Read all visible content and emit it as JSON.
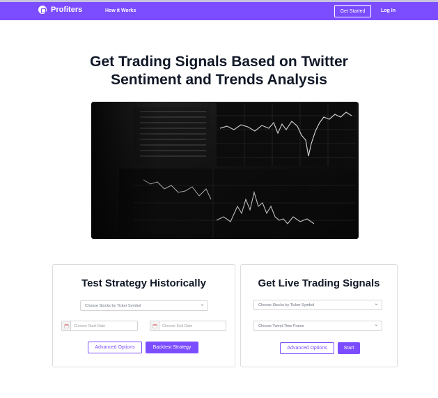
{
  "nav": {
    "brand": "Profiters",
    "how_it_works": "How it Works",
    "get_started": "Get Started",
    "log_in": "Log In"
  },
  "hero": {
    "title_line1": "Get Trading Signals Based on Twitter",
    "title_line2": "Sentiment and Trends Analysis"
  },
  "historical": {
    "title": "Test Strategy Historically",
    "ticker_placeholder": "Choose Stocks by Ticker Symbol",
    "start_date_placeholder": "Choose Start Date",
    "end_date_placeholder": "Choose End Date",
    "advanced_label": "Advanced Options",
    "backtest_label": "Backtest Strategy"
  },
  "live": {
    "title": "Get Live Trading Signals",
    "ticker_placeholder": "Choose Stocks by Ticker Symbol",
    "timeframe_placeholder": "Choose Tweet Time Frame",
    "advanced_label": "Advanced Options",
    "start_label": "Start"
  },
  "colors": {
    "accent": "#7c4dff",
    "text": "#111827"
  },
  "icons": {
    "brand": "logo-icon",
    "calendar": "calendar-icon",
    "chevron": "chevron-down-icon"
  }
}
